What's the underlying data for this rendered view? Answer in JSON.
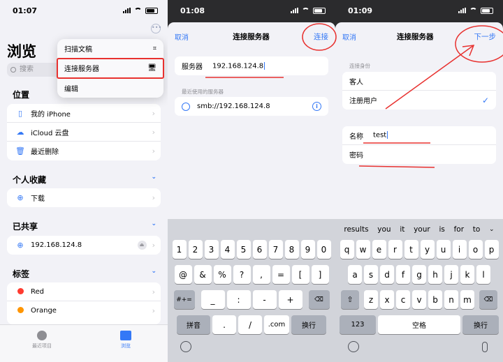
{
  "panels": [
    {
      "status": {
        "time": "01:07"
      },
      "title": "浏览",
      "search_placeholder": "搜索",
      "more_icon": "ellipsis-circle",
      "menu": [
        {
          "label": "扫描文稿",
          "icon": "scan-icon",
          "highlighted": false
        },
        {
          "label": "连接服务器",
          "icon": "monitor-icon",
          "highlighted": true
        },
        {
          "label": "编辑",
          "icon": "",
          "highlighted": false
        }
      ],
      "sections": {
        "locations": {
          "title": "位置",
          "items": [
            "我的 iPhone",
            "iCloud 云盘",
            "最近删除"
          ]
        },
        "favorites": {
          "title": "个人收藏",
          "items": [
            "下载"
          ]
        },
        "shared": {
          "title": "已共享",
          "items": [
            "192.168.124.8"
          ]
        },
        "tags": {
          "title": "标签",
          "items": [
            {
              "label": "Red",
              "color": "#ff3b30"
            },
            {
              "label": "Orange",
              "color": "#ff9500"
            }
          ]
        }
      },
      "tabs": [
        {
          "label": "最近项目",
          "active": false
        },
        {
          "label": "浏览",
          "active": true
        }
      ]
    },
    {
      "status": {
        "time": "01:08"
      },
      "nav": {
        "cancel": "取消",
        "title": "连接服务器",
        "action": "连接"
      },
      "server": {
        "label": "服务器",
        "value": "192.168.124.8"
      },
      "recent_caption": "最近使用的服务器",
      "recent": "smb://192.168.124.8",
      "suggestions": [],
      "keys": {
        "row1": [
          "1",
          "2",
          "3",
          "4",
          "5",
          "6",
          "7",
          "8",
          "9",
          "0"
        ],
        "row2": [
          "@",
          "&",
          "%",
          "?",
          ",",
          "=",
          "[",
          "]"
        ],
        "row3": [
          "#+=",
          "_",
          ":",
          "-",
          "+",
          "⌫"
        ],
        "row4": [
          "拼音",
          ".",
          "/",
          ".com",
          "换行"
        ]
      }
    },
    {
      "status": {
        "time": "01:09"
      },
      "nav": {
        "cancel": "取消",
        "title": "连接服务器",
        "action": "下一步"
      },
      "identity_caption": "连接身份",
      "identity": [
        {
          "label": "客人",
          "checked": false
        },
        {
          "label": "注册用户",
          "checked": true
        }
      ],
      "fields": [
        {
          "label": "名称",
          "value": "test"
        },
        {
          "label": "密码",
          "value": ""
        }
      ],
      "suggestions": [
        "results",
        "you",
        "it",
        "your",
        "is",
        "for",
        "to"
      ],
      "keys": {
        "row1": [
          "q",
          "w",
          "e",
          "r",
          "t",
          "y",
          "u",
          "i",
          "o",
          "p"
        ],
        "row2": [
          "a",
          "s",
          "d",
          "f",
          "g",
          "h",
          "j",
          "k",
          "l"
        ],
        "row3": [
          "⇧",
          "z",
          "x",
          "c",
          "v",
          "b",
          "n",
          "m",
          "⌫"
        ],
        "row4": [
          "123",
          "空格",
          "换行"
        ]
      }
    }
  ],
  "annotation_color": "#e8312f"
}
